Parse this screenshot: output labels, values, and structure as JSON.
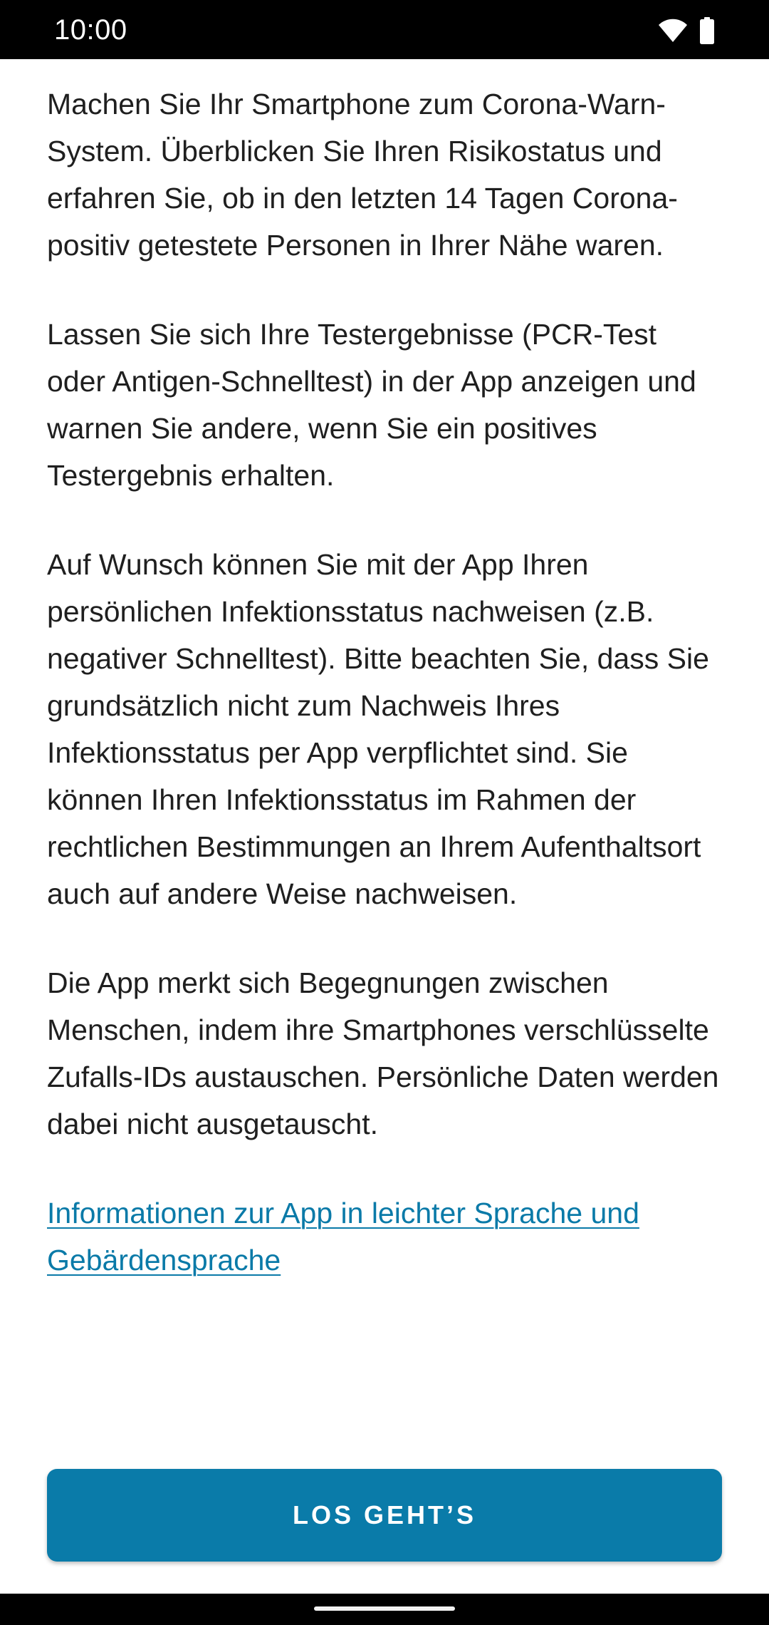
{
  "status_bar": {
    "time": "10:00",
    "icons": [
      "wifi-icon",
      "battery-icon"
    ]
  },
  "content": {
    "paragraphs": [
      "Machen Sie Ihr Smartphone zum Corona-Warn-System. Überblicken Sie Ihren Risikostatus und erfahren Sie, ob in den letzten 14 Tagen Corona-positiv getestete Personen in Ihrer Nähe waren.",
      "Lassen Sie sich Ihre Testergebnisse (PCR-Test oder Antigen-Schnelltest) in der App anzeigen und warnen Sie andere, wenn Sie ein positives Testergebnis erhalten.",
      "Auf Wunsch können Sie mit der App Ihren persönlichen Infektionsstatus nachweisen (z.B. negativer Schnelltest). Bitte beachten Sie, dass Sie grundsätzlich nicht zum Nachweis Ihres Infektionsstatus per App verpflichtet sind. Sie können Ihren Infektionsstatus im Rahmen der rechtlichen Bestimmungen an Ihrem Aufenthaltsort auch auf andere Weise nachweisen.",
      "Die App merkt sich Begegnungen zwischen Menschen, indem ihre Smartphones verschlüsselte Zufalls-IDs austauschen. Persönliche Daten werden dabei nicht ausgetauscht."
    ],
    "link_text": "Informationen zur App in leichter Sprache und Gebärdensprache"
  },
  "button": {
    "label": "LOS GEHT’S"
  },
  "colors": {
    "accent": "#0a7ba9",
    "link": "#0a7aa8",
    "text": "#1f1f1f"
  }
}
